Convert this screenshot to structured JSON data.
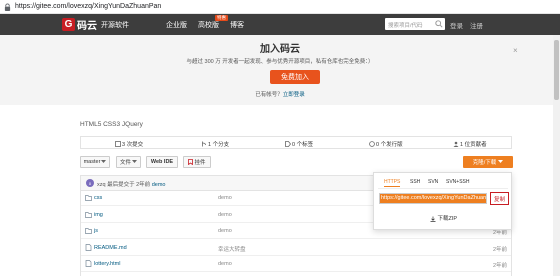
{
  "browser": {
    "url": "https://gitee.com/lovexzq/XingYunDaZhuanPan"
  },
  "nav": {
    "logo": "码云",
    "logo_mark": "G",
    "items": [
      "开源软件",
      "企业版",
      "高校版",
      "博客"
    ],
    "badge": "特惠",
    "search_placeholder": "搜索项目/代码",
    "login": "登录",
    "signup": "注册"
  },
  "banner": {
    "title": "加入码云",
    "subtitle": "与超过 300 万 开发者一起发现、参与优秀开源项目，私有仓库也完全免费：）",
    "join_button": "免费加入",
    "have_account": "已有帐号？",
    "login_link": "立即登录",
    "close": "×"
  },
  "repo": {
    "description": "HTML5 CSS3 JQuery",
    "stats": {
      "commits": "3 次提交",
      "branches": "1 个分支",
      "tags": "0 个标签",
      "releases": "0 个发行版",
      "contributors": "1 位贡献者"
    }
  },
  "toolbar": {
    "branch": "master",
    "file": "文件",
    "webide": "Web IDE",
    "issue": "挂件",
    "clone": "克隆/下载"
  },
  "commit": {
    "avatar": "x",
    "text": "xzq 最后提交于 2年前",
    "message": "demo"
  },
  "files": [
    {
      "name": "css",
      "type": "folder",
      "message": "demo",
      "time": "2年前"
    },
    {
      "name": "img",
      "type": "folder",
      "message": "demo",
      "time": "2年前"
    },
    {
      "name": "js",
      "type": "folder",
      "message": "demo",
      "time": "2年前"
    },
    {
      "name": "README.md",
      "type": "file",
      "message": "幸运大转盘",
      "time": "2年前"
    },
    {
      "name": "lottery.html",
      "type": "file",
      "message": "demo",
      "time": "2年前"
    }
  ],
  "clone_popup": {
    "tabs": [
      "HTTPS",
      "SSH",
      "SVN",
      "SVN+SSH"
    ],
    "active_tab": "HTTPS",
    "url_value": "https://gitee.com/lovexzq/XingYunDaZhuanPan.git",
    "copy": "复制",
    "download": "下载ZIP"
  },
  "colors": {
    "brand": "#c71d23",
    "accent": "#ee7f20",
    "navbar": "#3d3d3d",
    "link": "#005980"
  }
}
